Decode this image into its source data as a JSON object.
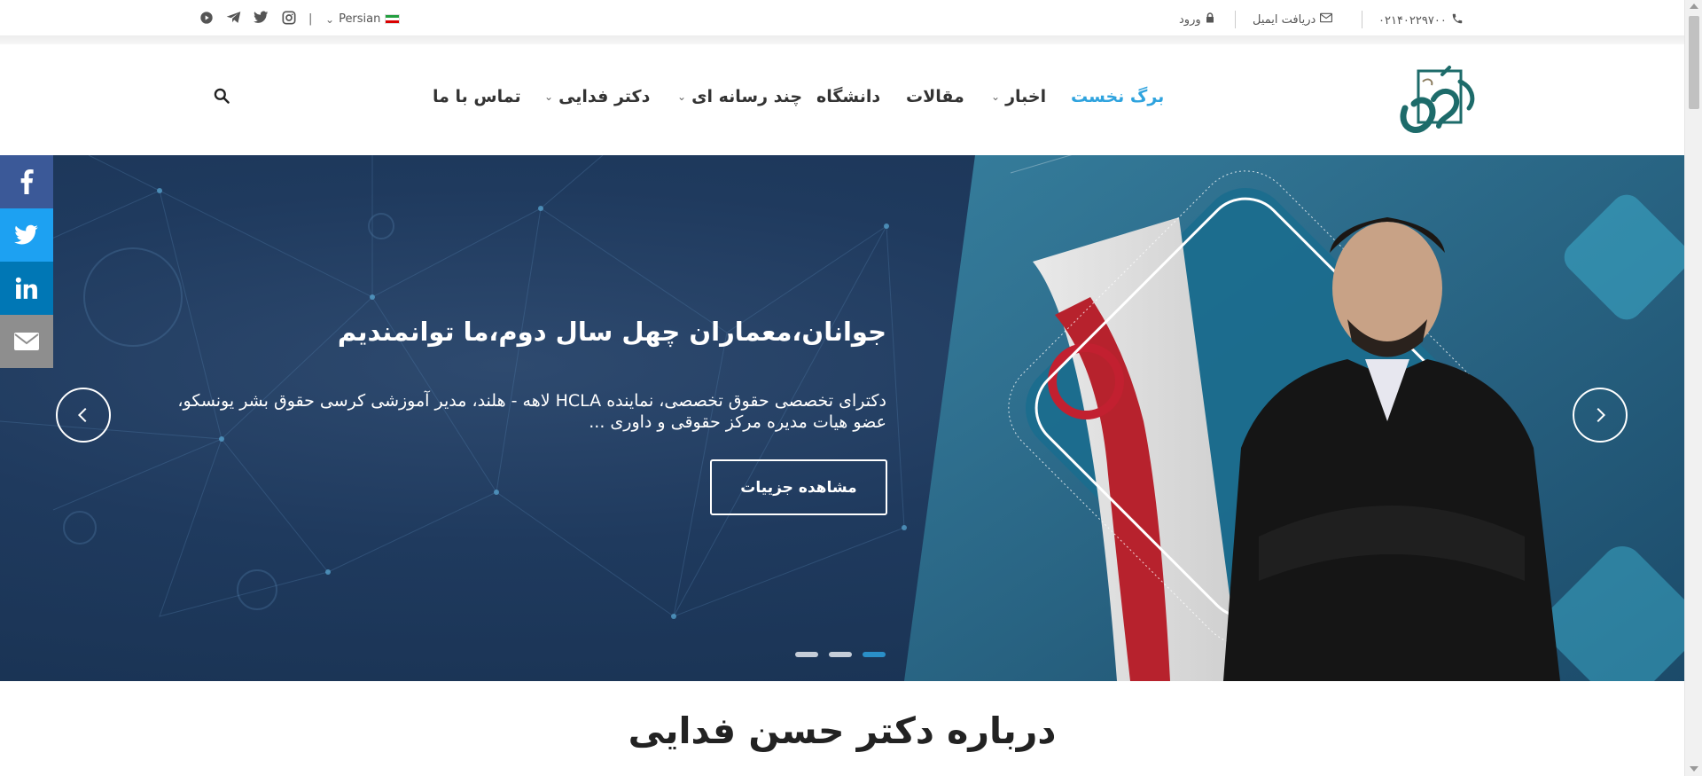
{
  "topbar": {
    "phone": "۰۲۱۴۰۲۲۹۷۰۰",
    "email_label": "دریافت ایمیل",
    "login_label": "ورود",
    "language": "Persian",
    "social_icons": [
      "instagram-icon",
      "twitter-icon",
      "telegram-icon",
      "youtube-icon"
    ]
  },
  "nav": {
    "items": [
      {
        "label": "برگ نخست",
        "active": true,
        "dropdown": false
      },
      {
        "label": "اخبار",
        "active": false,
        "dropdown": true
      },
      {
        "label": "مقالات",
        "active": false,
        "dropdown": false
      },
      {
        "label": "دانشگاه",
        "active": false,
        "dropdown": false
      },
      {
        "label": "چند رسانه ای",
        "active": false,
        "dropdown": true
      },
      {
        "label": "دکتر فدایی",
        "active": false,
        "dropdown": true
      },
      {
        "label": "تماس با ما",
        "active": false,
        "dropdown": false
      }
    ]
  },
  "hero": {
    "title": "جوانان،معماران چهل سال دوم،ما توانمندیم",
    "description": "دکترای تخصصی حقوق تخصصی، نماینده HCLA لاهه - هلند، مدیر آموزشی کرسی حقوق بشر یونسکو، عضو هیات مدیره مرکز حقوقی و داوری ...",
    "button_label": "مشاهده جزییات",
    "slides": 3,
    "active_slide": 3
  },
  "share": [
    "facebook-icon",
    "twitter-icon",
    "linkedin-icon",
    "email-icon"
  ],
  "about": {
    "title": "درباره دکتر حسن فدایی"
  },
  "colors": {
    "accent": "#2fa3de",
    "facebook": "#3b5998",
    "twitter": "#1da1f2",
    "linkedin": "#0077b5",
    "email": "#8e8e8e",
    "hero_bg": "#1f3a5e"
  }
}
